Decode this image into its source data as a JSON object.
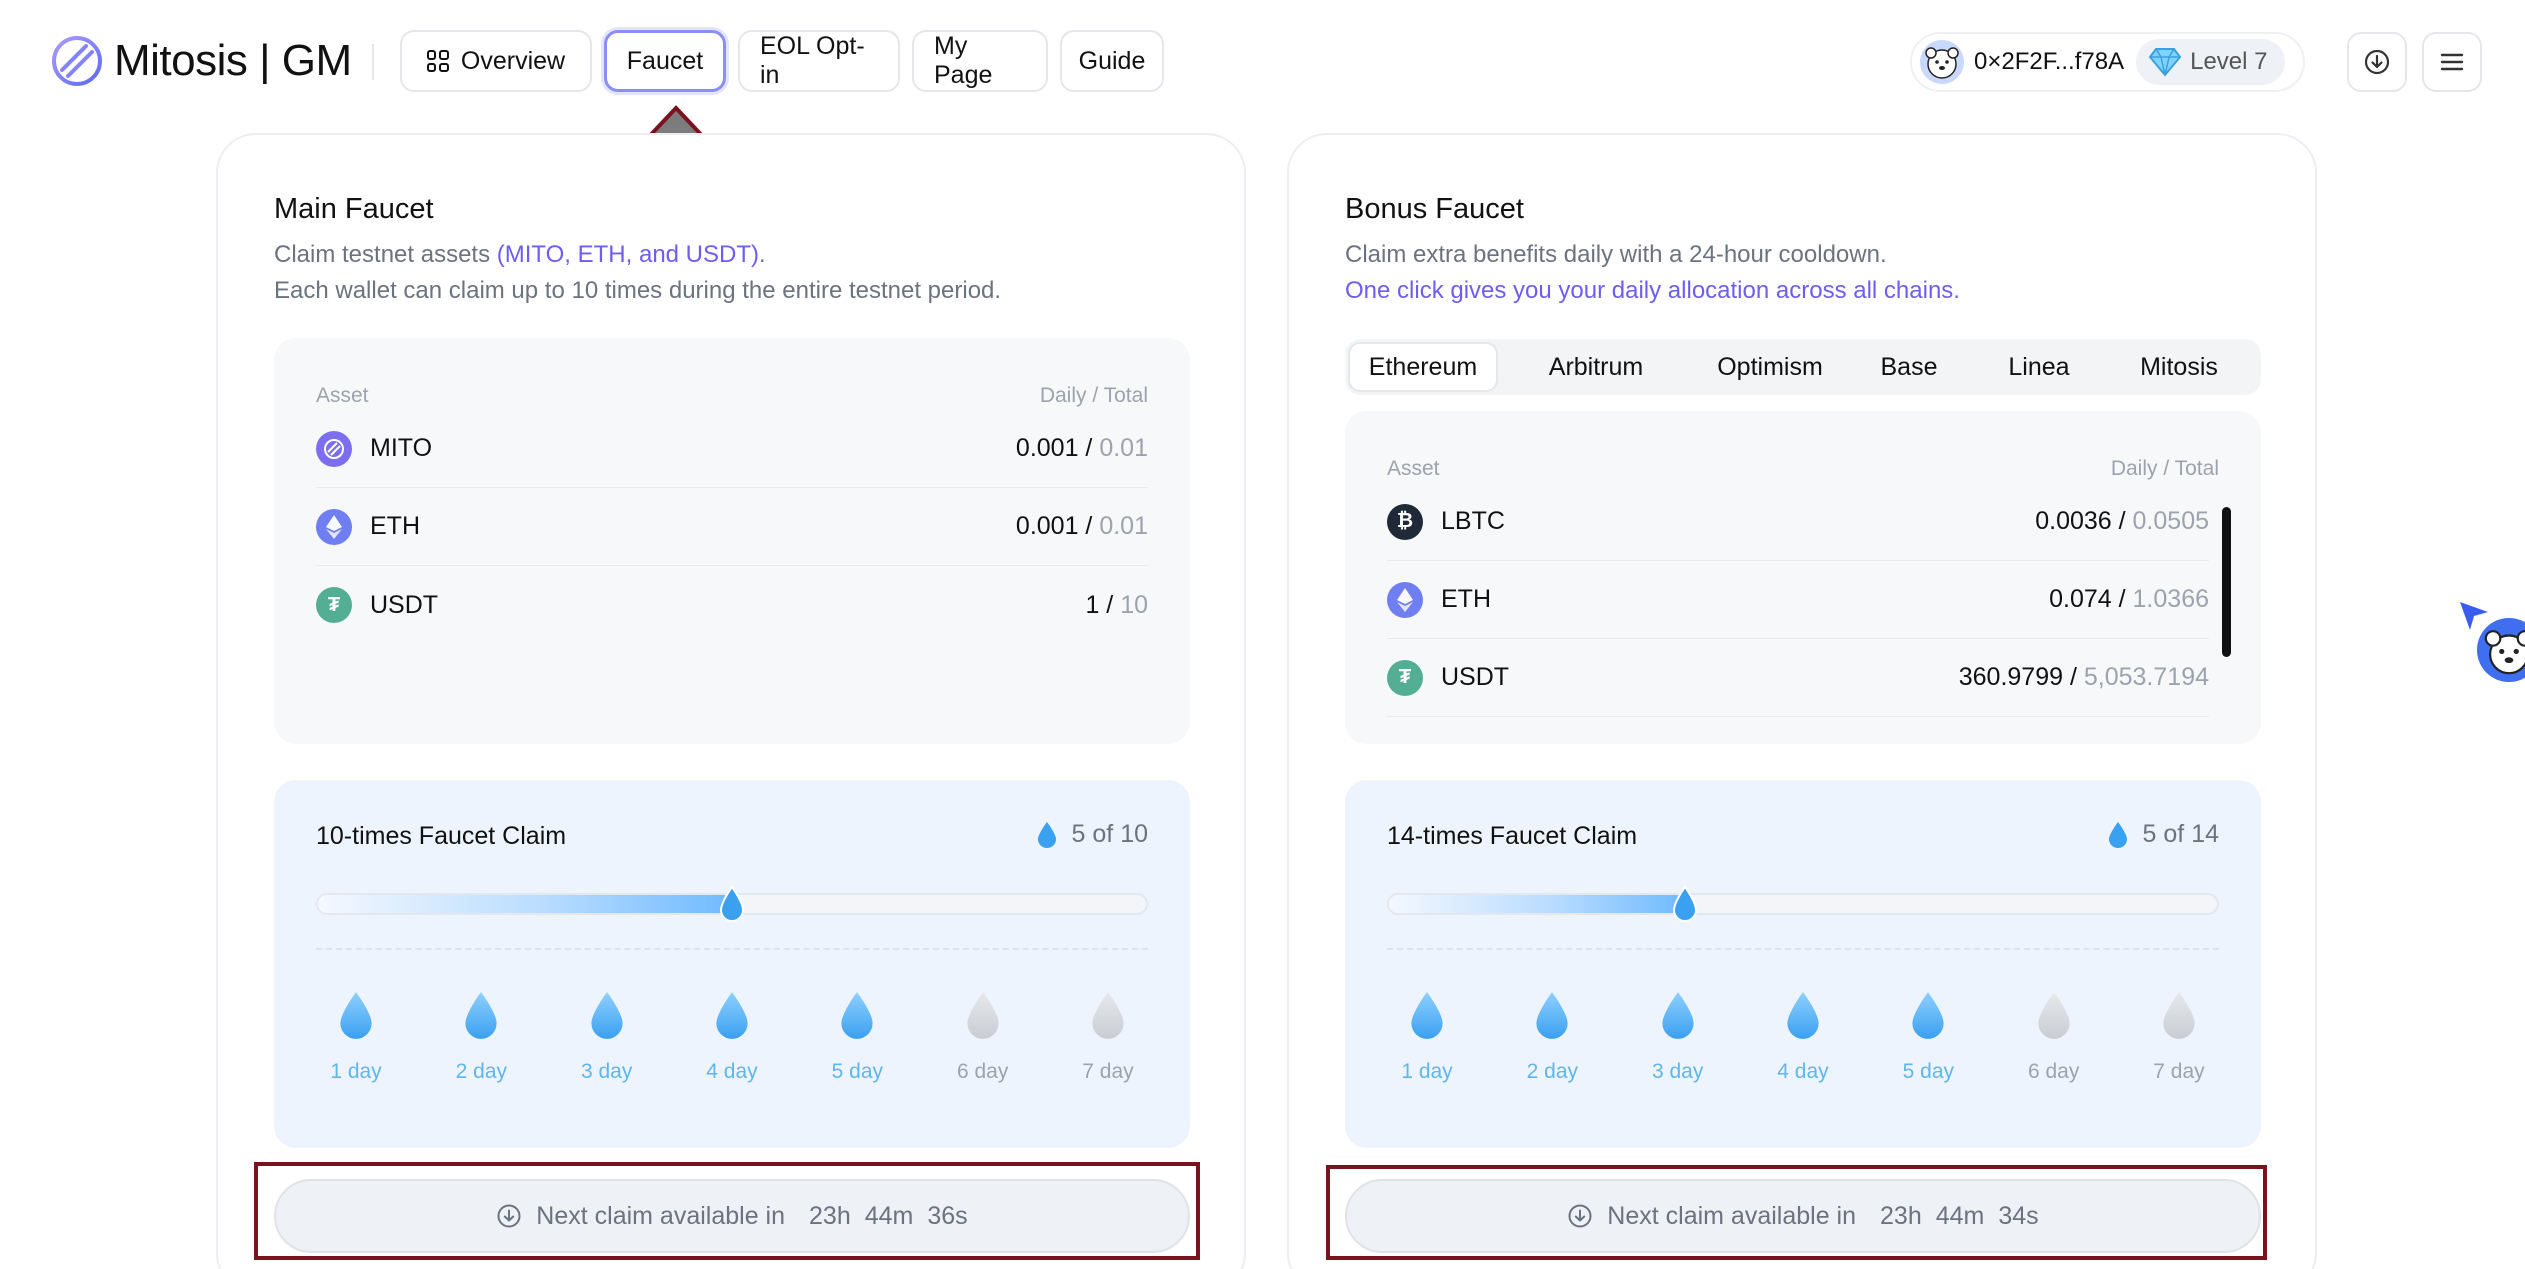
{
  "brand": {
    "name": "Mitosis | GM"
  },
  "nav": {
    "items": [
      {
        "label": "Overview",
        "icon": "grid-icon"
      },
      {
        "label": "Faucet",
        "active": true
      },
      {
        "label": "EOL Opt-in"
      },
      {
        "label": "My Page"
      },
      {
        "label": "Guide"
      }
    ]
  },
  "wallet": {
    "address": "0×2F2F...f78A",
    "level": "Level 7"
  },
  "main_faucet": {
    "title": "Main Faucet",
    "desc_prefix": "Claim testnet assets ",
    "desc_highlight": "(MITO, ETH, and USDT)",
    "desc_suffix": ".",
    "desc_line2": "Each wallet can claim up to 10 times during the entire testnet period.",
    "asset_header": "Asset",
    "value_header": "Daily / Total",
    "assets": [
      {
        "name": "MITO",
        "daily": "0.001",
        "sep": " / ",
        "total": "0.01",
        "color": "#7b6ff0"
      },
      {
        "name": "ETH",
        "daily": "0.001",
        "sep": " / ",
        "total": "0.01",
        "color": "#6f7ef0"
      },
      {
        "name": "USDT",
        "daily": "1",
        "sep": " / ",
        "total": "10",
        "color": "#53ae94"
      }
    ],
    "claim_title": "10-times Faucet Claim",
    "claim_count": "5 of 10",
    "claimed": 5,
    "total_claims": 10,
    "days": [
      "1 day",
      "2 day",
      "3 day",
      "4 day",
      "5 day",
      "6 day",
      "7 day"
    ],
    "days_done": 5,
    "next_label": "Next claim available in",
    "next_h": "23h",
    "next_m": "44m",
    "next_s": "36s"
  },
  "bonus_faucet": {
    "title": "Bonus Faucet",
    "desc_line1": "Claim extra benefits daily with a 24-hour cooldown.",
    "desc_line2": "One click gives you your daily allocation across all chains.",
    "tabs": [
      "Ethereum",
      "Arbitrum",
      "Optimism",
      "Base",
      "Linea",
      "Mitosis"
    ],
    "active_tab": "Ethereum",
    "asset_header": "Asset",
    "value_header": "Daily / Total",
    "assets": [
      {
        "name": "LBTC",
        "daily": "0.0036",
        "sep": " / ",
        "total": "0.0505",
        "color": "#1f2937"
      },
      {
        "name": "ETH",
        "daily": "0.074",
        "sep": " / ",
        "total": "1.0366",
        "color": "#6f7ef0"
      },
      {
        "name": "USDT",
        "daily": "360.9799",
        "sep": " / ",
        "total": "5,053.7194",
        "color": "#53ae94"
      }
    ],
    "claim_title": "14-times Faucet Claim",
    "claim_count": "5 of 14",
    "claimed": 5,
    "total_claims": 14,
    "days": [
      "1 day",
      "2 day",
      "3 day",
      "4 day",
      "5 day",
      "6 day",
      "7 day"
    ],
    "days_done": 5,
    "next_label": "Next claim available in",
    "next_h": "23h",
    "next_m": "44m",
    "next_s": "34s"
  },
  "colors": {
    "accent": "#6d5df3",
    "drop_on": "#3aa0f0",
    "drop_off": "#c9cdd3",
    "annotation": "#7a1220"
  }
}
